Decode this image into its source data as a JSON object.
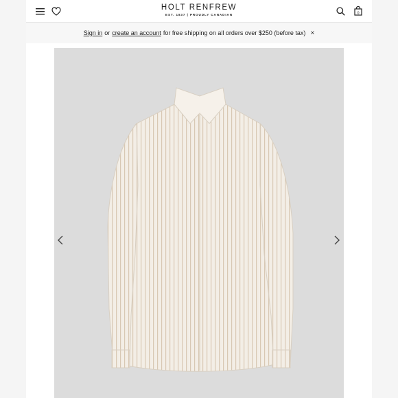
{
  "header": {
    "brand_name": "HOLT RENFREW",
    "brand_tagline": "EST. 1837 | PROUDLY CANADIAN",
    "icons": [
      "menu-icon",
      "heart-icon",
      "search-icon",
      "bag-icon"
    ],
    "bag_count": "0"
  },
  "promo": {
    "sign_in": "Sign in",
    "or": "or",
    "create_account": "create an account",
    "message": "for free shipping on all orders over $250 (before tax)",
    "close": "×"
  },
  "gallery": {
    "image": "striped button-up shirt",
    "colors": {
      "background": "#dcdcdc",
      "shirt": "#f3eee6",
      "stripe": "#d8c8b3"
    }
  }
}
